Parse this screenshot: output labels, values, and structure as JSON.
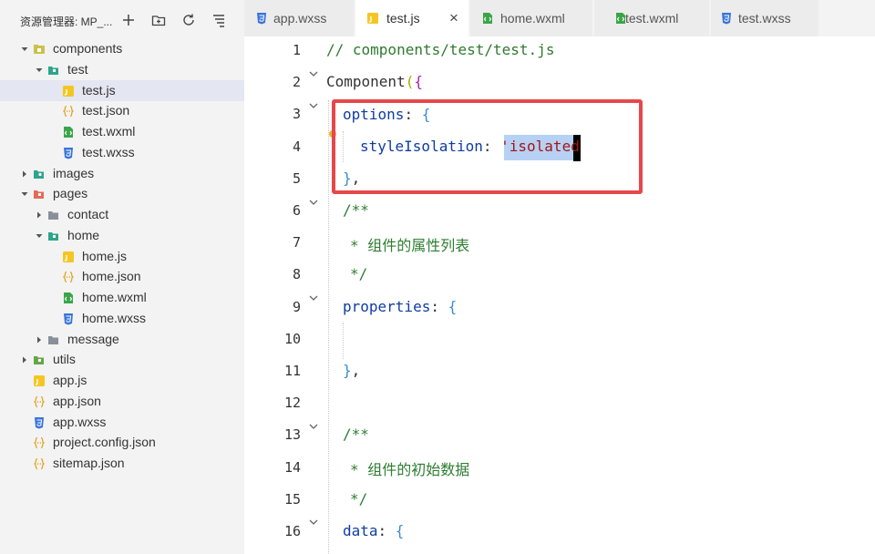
{
  "sidebar": {
    "title": "资源管理器: MP_...",
    "tree": [
      {
        "label": "components",
        "icon": "folder-components-icon",
        "selected": false
      },
      {
        "label": "test",
        "icon": "folder-open-icon",
        "selected": false
      },
      {
        "label": "test.js",
        "icon": "js-file-icon",
        "selected": true
      },
      {
        "label": "test.json",
        "icon": "json-file-icon",
        "selected": false
      },
      {
        "label": "test.wxml",
        "icon": "wxml-file-icon",
        "selected": false
      },
      {
        "label": "test.wxss",
        "icon": "wxss-file-icon",
        "selected": false
      },
      {
        "label": "images",
        "icon": "folder-images-icon",
        "selected": false
      },
      {
        "label": "pages",
        "icon": "folder-pages-icon",
        "selected": false
      },
      {
        "label": "contact",
        "icon": "folder-icon",
        "selected": false
      },
      {
        "label": "home",
        "icon": "folder-open-icon",
        "selected": false
      },
      {
        "label": "home.js",
        "icon": "js-file-icon",
        "selected": false
      },
      {
        "label": "home.json",
        "icon": "json-file-icon",
        "selected": false
      },
      {
        "label": "home.wxml",
        "icon": "wxml-file-icon",
        "selected": false
      },
      {
        "label": "home.wxss",
        "icon": "wxss-file-icon",
        "selected": false
      },
      {
        "label": "message",
        "icon": "folder-icon",
        "selected": false
      },
      {
        "label": "utils",
        "icon": "folder-utils-icon",
        "selected": false
      },
      {
        "label": "app.js",
        "icon": "js-file-icon",
        "selected": false
      },
      {
        "label": "app.json",
        "icon": "json-file-icon",
        "selected": false
      },
      {
        "label": "app.wxss",
        "icon": "wxss-file-icon",
        "selected": false
      },
      {
        "label": "project.config.json",
        "icon": "json-file-icon",
        "selected": false
      },
      {
        "label": "sitemap.json",
        "icon": "json-file-icon",
        "selected": false
      }
    ]
  },
  "tabs": [
    {
      "label": "app.wxss",
      "icon": "wxss-file-icon",
      "active": false
    },
    {
      "label": "test.js",
      "icon": "js-file-icon",
      "active": true,
      "close": "×"
    },
    {
      "label": "home.wxml",
      "icon": "wxml-file-icon",
      "active": false
    },
    {
      "label": "test.wxml",
      "icon": "wxml-file-icon",
      "active": false
    },
    {
      "label": "test.wxss",
      "icon": "wxss-file-icon",
      "active": false
    }
  ],
  "editor": {
    "line_numbers": [
      "1",
      "2",
      "3",
      "4",
      "5",
      "6",
      "7",
      "8",
      "9",
      "10",
      "11",
      "12",
      "13",
      "14",
      "15",
      "16"
    ],
    "code": {
      "l1": "// components/test/test.js",
      "l2_name": "Component",
      "l2_paren": "(",
      "l2_brace": "{",
      "l3_key": "options",
      "l3_colon": ": ",
      "l3_brace": "{",
      "l4_key": "styleIsolation",
      "l4_colon": ": ",
      "l4_quote": "'",
      "l4_value": "isolated",
      "l5_brace": "}",
      "l5_comma": ",",
      "l6": "/**",
      "l7": "* 组件的属性列表",
      "l8": "*/",
      "l9_key": "properties",
      "l9_colon": ": ",
      "l9_brace": "{",
      "l11_brace": "}",
      "l11_comma": ",",
      "l13": "/**",
      "l14": "* 组件的初始数据",
      "l15": "*/",
      "l16_key": "data",
      "l16_colon": ": ",
      "l16_brace": "{"
    }
  },
  "colors": {
    "highlight_box": "#e8474a",
    "selection": "#b7d1f4",
    "sidebar_bg": "#f3f3f3",
    "selected_row": "#e4e6f1"
  }
}
